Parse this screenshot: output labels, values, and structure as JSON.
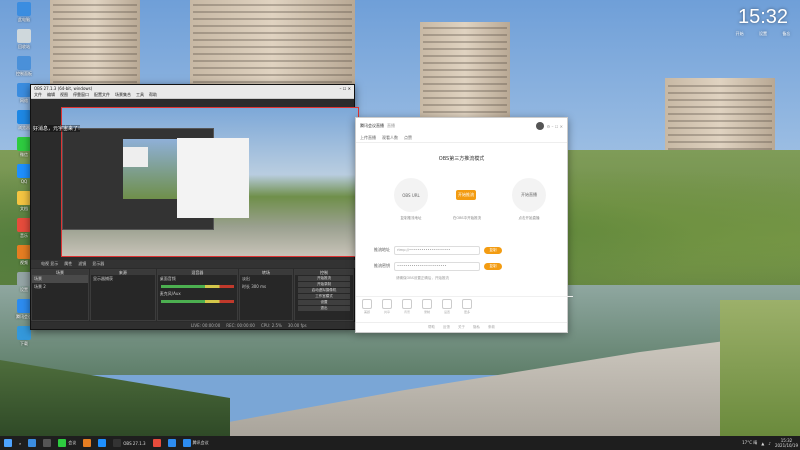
{
  "desktop": {
    "icons": [
      {
        "label": "此电脑",
        "color": "#3b8de0"
      },
      {
        "label": "回收站",
        "color": "#cfd8dc"
      },
      {
        "label": "控制面板",
        "color": "#4a90d9"
      },
      {
        "label": "网络",
        "color": "#3b8de0"
      },
      {
        "label": "浏览器",
        "color": "#1e88e5"
      },
      {
        "label": "微信",
        "color": "#2ecc40"
      },
      {
        "label": "QQ",
        "color": "#1e90ff"
      },
      {
        "label": "文档",
        "color": "#f5c542"
      },
      {
        "label": "音乐",
        "color": "#e74c3c"
      },
      {
        "label": "视频",
        "color": "#e67e22"
      },
      {
        "label": "设置",
        "color": "#95a5a6"
      },
      {
        "label": "腾讯会议",
        "color": "#2d8cf0"
      },
      {
        "label": "下载",
        "color": "#3498db"
      }
    ],
    "clock": {
      "time": "15:32",
      "row1": [
        "开始",
        "设置",
        "备忘"
      ]
    }
  },
  "obs": {
    "title": "OBS 27.1.3 (64-bit, windows)",
    "menus": [
      "文件",
      "编辑",
      "视图",
      "停靠窗口",
      "配置文件",
      "场景集合",
      "工具",
      "帮助"
    ],
    "overlay_text": "好消息，元宇宙来了!",
    "scene_bar": [
      "电视 显示",
      "属性",
      "滤镜",
      "显示器"
    ],
    "docks": {
      "scenes": {
        "title": "场景",
        "items": [
          "场景",
          "场景 2"
        ]
      },
      "sources": {
        "title": "来源",
        "items": [
          "显示器捕获"
        ]
      },
      "mixer": {
        "title": "混音器",
        "items": [
          "桌面音频",
          "麦克风/Aux"
        ]
      },
      "transitions": {
        "title": "转场",
        "items": [
          "淡出",
          "时长 300 ms"
        ]
      },
      "controls": {
        "title": "控制",
        "items": [
          "开始推流",
          "开始录制",
          "启动虚拟摄像机",
          "工作室模式",
          "设置",
          "退出"
        ]
      }
    },
    "status": [
      "LIVE: 00:00:00",
      "REC: 00:00:00",
      "CPU: 2.5%",
      "30.00 fps"
    ]
  },
  "app": {
    "title": "腾讯会议直播",
    "tabs": [
      "直播",
      "互动"
    ],
    "subtitle_items": [
      "上传直播",
      "观看人数",
      "点赞"
    ],
    "section_title": "OBS第三方推流模式",
    "steps": [
      {
        "label": "OBS URL",
        "caption": "复制推流地址"
      },
      {
        "label": "开始推流",
        "caption": "在OBS中开始推流"
      },
      {
        "label": "开始直播",
        "caption": "点击开始直播"
      }
    ],
    "fields": [
      {
        "label": "推流地址",
        "value": "rtmp://••••••••••••••••••••",
        "action": "复制"
      },
      {
        "label": "推流密钥",
        "value": "••••••••••••••••••••••••",
        "action": "复制"
      }
    ],
    "note": "请确保OBS设置正确后，开始推流",
    "toolbar": [
      "美颜",
      "共享",
      "背景",
      "录制",
      "设置",
      "更多"
    ],
    "footer": [
      "帮助",
      "反馈",
      "关于",
      "隐私",
      "条款"
    ]
  },
  "taskbar": {
    "items": [
      {
        "label": "",
        "color": "#3b8de0"
      },
      {
        "label": "",
        "color": "#555"
      },
      {
        "label": "会议",
        "color": "#2ecc40"
      },
      {
        "label": "",
        "color": "#e67e22"
      },
      {
        "label": "",
        "color": "#1e90ff"
      },
      {
        "label": "OBS 27.1.3",
        "color": "#333"
      },
      {
        "label": "",
        "color": "#e74c3c"
      },
      {
        "label": "",
        "color": "#2d8cf0"
      },
      {
        "label": "腾讯会议",
        "color": "#2d8cf0"
      }
    ],
    "weather": "17°C 晴",
    "time": "15:32",
    "date": "2021/10/19"
  }
}
